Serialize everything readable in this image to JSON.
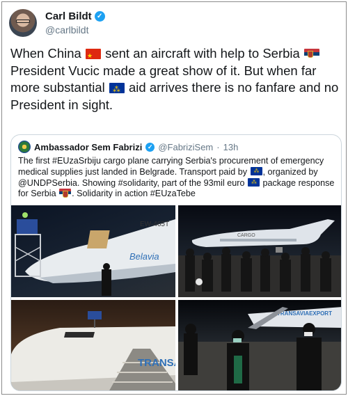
{
  "author": {
    "display_name": "Carl Bildt",
    "handle": "@carlbildt",
    "verified": true
  },
  "tweet": {
    "segments": [
      {
        "type": "text",
        "value": "When China "
      },
      {
        "type": "flag",
        "value": "flag-china-icon"
      },
      {
        "type": "text",
        "value": " sent an aircraft with help to Serbia "
      },
      {
        "type": "flag",
        "value": "flag-serbia-icon"
      },
      {
        "type": "text",
        "value": " President Vucic made a great show of it. But when far more substantial "
      },
      {
        "type": "flag",
        "value": "flag-eu-icon"
      },
      {
        "type": "text",
        "value": " aid arrives there is no fanfare and no President in sight."
      }
    ]
  },
  "quoted": {
    "display_name": "Ambassador Sem Fabrizi",
    "handle": "@FabriziSem",
    "separator": "·",
    "time": "13h",
    "verified": true,
    "segments": [
      {
        "type": "text",
        "value": "The first #EUzaSrbiju cargo plane carrying Serbia's procurement of emergency medical supplies just landed in Belgrade. Transport paid by "
      },
      {
        "type": "flag",
        "value": "flag-eu-icon"
      },
      {
        "type": "text",
        "value": ", organized by @UNDPSerbia. Showing #solidarity, part of the 93mil euro "
      },
      {
        "type": "flag",
        "value": "flag-eu-icon"
      },
      {
        "type": "text",
        "value": " package response for Serbia "
      },
      {
        "type": "flag",
        "value": "flag-serbia-icon"
      },
      {
        "type": "text",
        "value": ". Solidarity in action #EUzaTebe"
      }
    ],
    "photos": [
      {
        "name": "photo-cargo-plane-unloading",
        "plane_text": "EW-465T",
        "livery_text": "Belavia"
      },
      {
        "name": "photo-press-conference-tarmac",
        "plane_text": "CARGO"
      },
      {
        "name": "photo-plane-nose",
        "livery_text": "TRANSA"
      },
      {
        "name": "photo-officials-walking",
        "livery_text": "TRANSAVIAEXPORT"
      }
    ]
  },
  "colors": {
    "verified_blue": "#1da1f2",
    "secondary_text": "#657786",
    "border": "#ccd6dd"
  }
}
